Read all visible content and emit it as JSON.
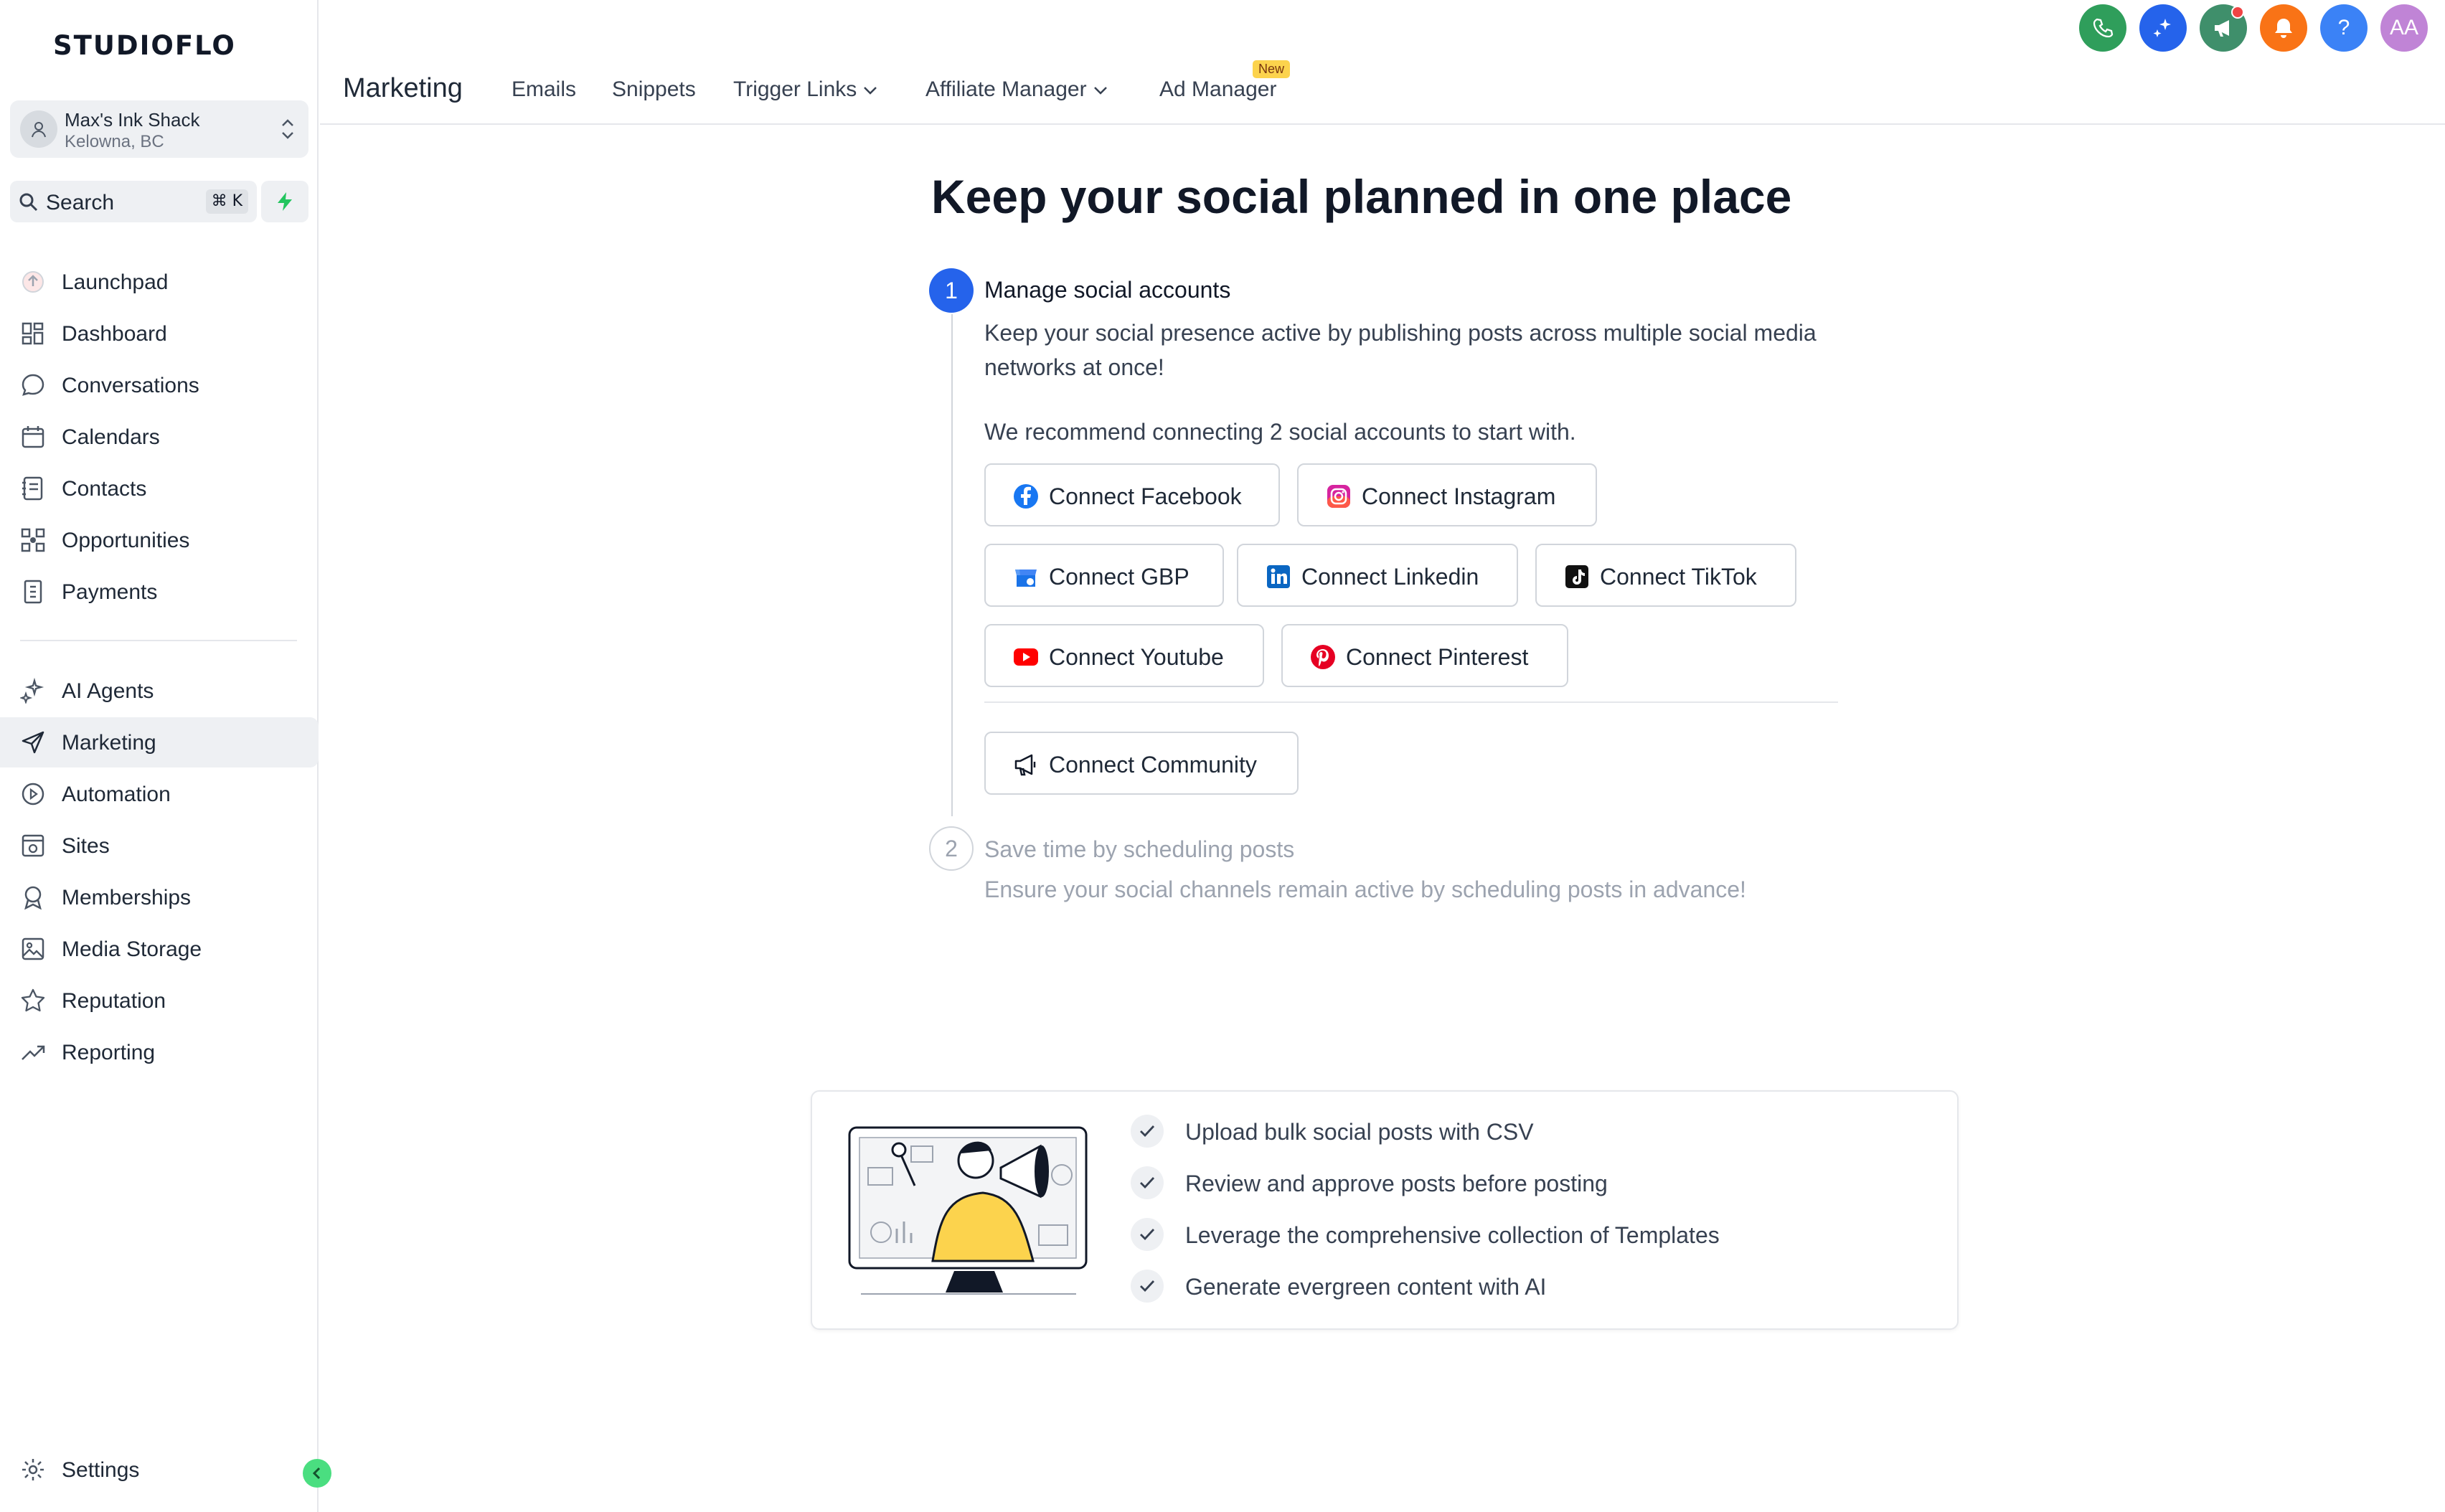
{
  "app": {
    "logo": "STUDIOFLO"
  },
  "account": {
    "name": "Max's Ink Shack",
    "location": "Kelowna, BC"
  },
  "search": {
    "label": "Search",
    "shortcut": "⌘ K"
  },
  "sidebar": {
    "items": [
      {
        "label": "Launchpad",
        "icon": "launchpad-icon"
      },
      {
        "label": "Dashboard",
        "icon": "dashboard-icon"
      },
      {
        "label": "Conversations",
        "icon": "chat-icon"
      },
      {
        "label": "Calendars",
        "icon": "calendar-icon"
      },
      {
        "label": "Contacts",
        "icon": "contacts-icon"
      },
      {
        "label": "Opportunities",
        "icon": "opportunities-icon"
      },
      {
        "label": "Payments",
        "icon": "payments-icon"
      },
      {
        "label": "AI Agents",
        "icon": "sparkles-icon"
      },
      {
        "label": "Marketing",
        "icon": "send-icon",
        "active": true
      },
      {
        "label": "Automation",
        "icon": "automation-icon"
      },
      {
        "label": "Sites",
        "icon": "sites-icon"
      },
      {
        "label": "Memberships",
        "icon": "award-icon"
      },
      {
        "label": "Media Storage",
        "icon": "image-icon"
      },
      {
        "label": "Reputation",
        "icon": "star-icon"
      },
      {
        "label": "Reporting",
        "icon": "trend-icon"
      }
    ],
    "settings_label": "Settings"
  },
  "header": {
    "title": "Marketing",
    "tabs": [
      {
        "label": "Emails"
      },
      {
        "label": "Snippets"
      },
      {
        "label": "Trigger Links"
      },
      {
        "label": "Affiliate Manager"
      },
      {
        "label": "Ad Manager"
      }
    ],
    "new_badge": "New",
    "avatar_initials": "AA",
    "help_glyph": "?"
  },
  "main": {
    "heading": "Keep your social planned in one place",
    "step1": {
      "number": "1",
      "title": "Manage social accounts",
      "description": "Keep your social presence active by publishing posts across multiple social media networks at once!",
      "recommend": "We recommend connecting 2 social accounts to start with."
    },
    "buttons": {
      "facebook": "Connect Facebook",
      "instagram": "Connect Instagram",
      "gbp": "Connect GBP",
      "linkedin": "Connect Linkedin",
      "tiktok": "Connect TikTok",
      "youtube": "Connect Youtube",
      "pinterest": "Connect Pinterest",
      "community": "Connect Community"
    },
    "step2": {
      "number": "2",
      "title": "Save time by scheduling posts",
      "description": "Ensure your social channels remain active by scheduling posts in advance!"
    }
  },
  "features": [
    "Upload bulk social posts with CSV",
    "Review and approve posts before posting",
    "Leverage the comprehensive collection of Templates",
    "Generate evergreen content with AI"
  ],
  "colors": {
    "primary": "#2563eb",
    "phone": "#2f9e5b",
    "ai": "#2563eb",
    "announce": "#3f8f6b",
    "bell": "#f97316",
    "help": "#3b82f6",
    "avatar": "#c084d6"
  }
}
